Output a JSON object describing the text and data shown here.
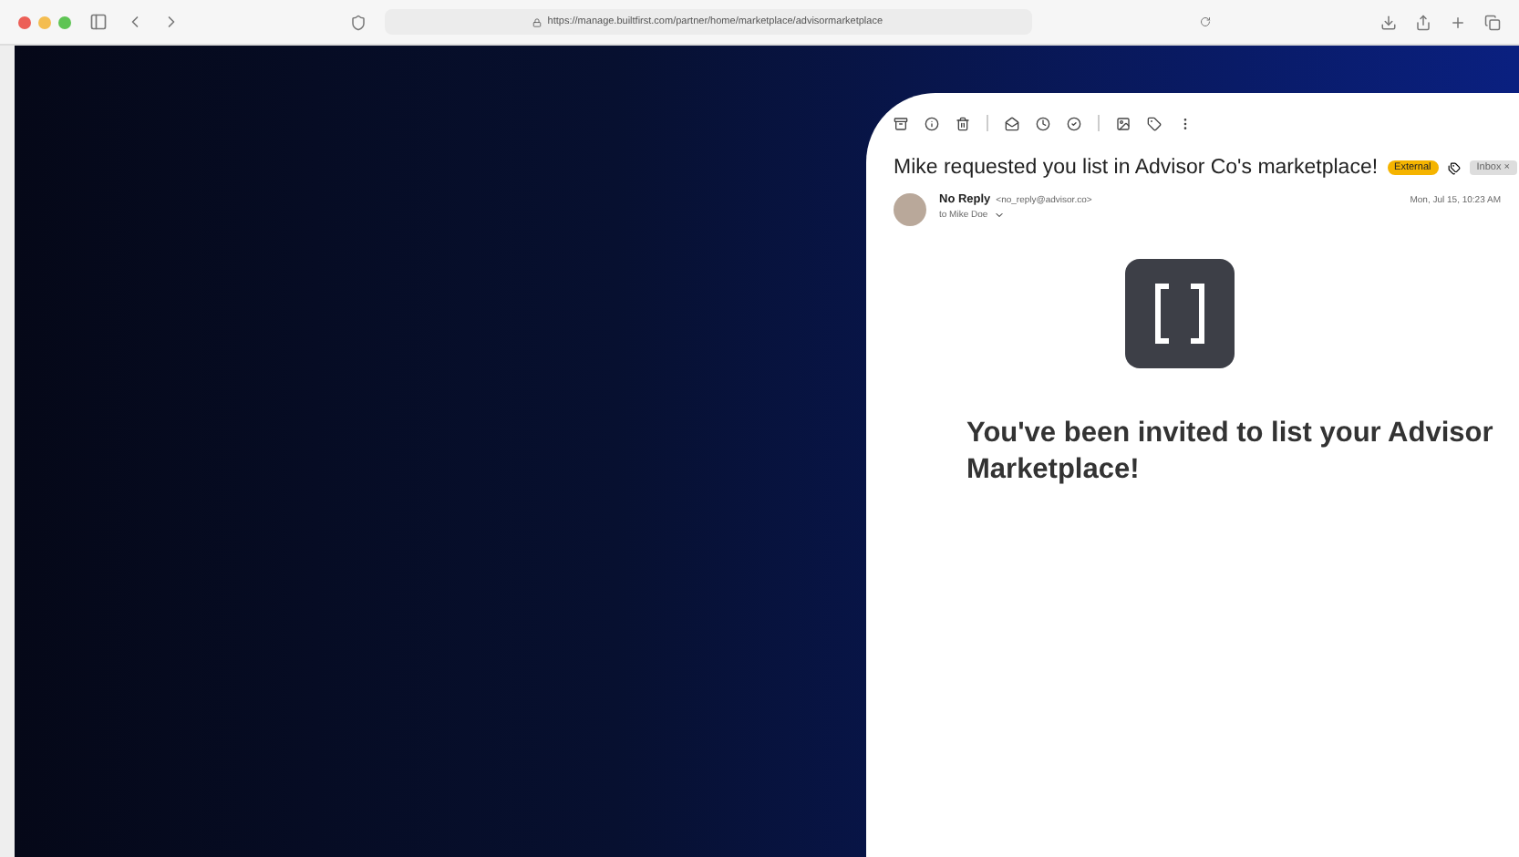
{
  "browser": {
    "url": "https://manage.builtfirst.com/partner/home/marketplace/advisormarketplace"
  },
  "email": {
    "subject": "Mike requested you list in Advisor Co's marketplace!",
    "labels": [
      {
        "kind": "external",
        "text": "External"
      },
      {
        "kind": "inbox",
        "text": "Inbox ×"
      }
    ],
    "sender_name": "No Reply",
    "sender_address": "<no_reply@advisor.co>",
    "recipient": "to Mike Doe",
    "date": "Mon, Jul 15, 10:23 AM",
    "body_heading": "You've been invited to list your Advisor",
    "body_heading_2": "Marketplace!"
  }
}
